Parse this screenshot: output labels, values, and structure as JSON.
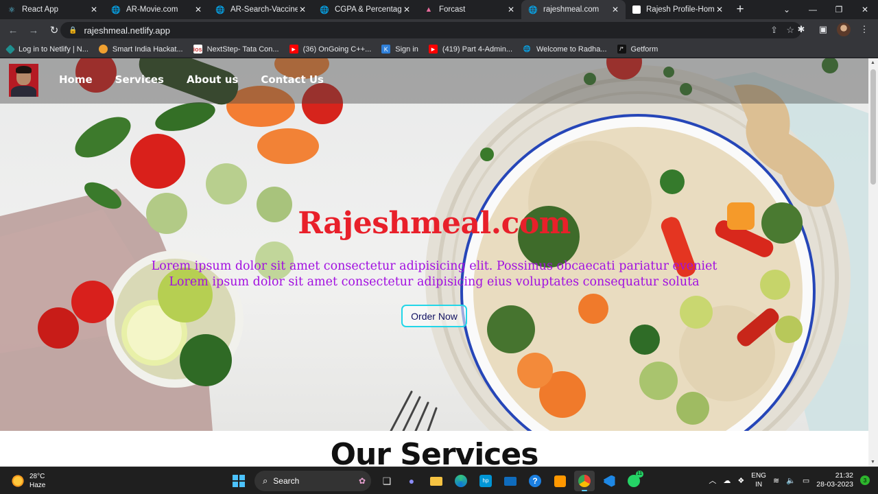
{
  "browser": {
    "tabs": [
      {
        "title": "React App",
        "icon": "react-icon",
        "active": false
      },
      {
        "title": "AR-Movie.com",
        "icon": "globe-icon",
        "active": false
      },
      {
        "title": "AR-Search-Vaccine-p",
        "icon": "globe-icon",
        "active": false
      },
      {
        "title": "CGPA & Percentag",
        "icon": "globe-icon",
        "active": false
      },
      {
        "title": "Forcast",
        "icon": "forecast-icon",
        "active": false
      },
      {
        "title": "rajeshmeal.com",
        "icon": "globe-icon",
        "active": true
      },
      {
        "title": "Rajesh Profile-Home",
        "icon": "page-icon",
        "active": false
      }
    ],
    "url": "rajeshmeal.netlify.app",
    "bookmarks": [
      {
        "label": "Log in to Netlify | N...",
        "icon": "netlify-icon",
        "color": "#1f8f8f"
      },
      {
        "label": "Smart India Hackat...",
        "icon": "sih-icon",
        "color": "#f0a030"
      },
      {
        "label": "NextStep- Tata Con...",
        "icon": "tcs-icon",
        "color": "#d04040"
      },
      {
        "label": "(36) OnGoing C++...",
        "icon": "youtube-icon",
        "color": "#ff0000"
      },
      {
        "label": "Sign in",
        "icon": "kotlin-icon",
        "color": "#2f7fd8"
      },
      {
        "label": "(419) Part 4-Admin...",
        "icon": "youtube-icon",
        "color": "#ff0000"
      },
      {
        "label": "Welcome to Radha...",
        "icon": "globe-icon",
        "color": "#888888"
      },
      {
        "label": "Getform",
        "icon": "getform-icon",
        "color": "#222222"
      }
    ]
  },
  "site": {
    "nav": {
      "home": "Home",
      "services": "Services",
      "about": "About us",
      "contact": "Contact Us"
    },
    "hero": {
      "title": "Rajeshmeal.com",
      "line1": "Lorem ipsum dolor sit amet consectetur adipisicing elit. Possimus obcaecati pariatur eveniet",
      "line2": "Lorem ipsum dolor sit amet consectetur adipisicing eius voluptates consequatur soluta",
      "button": "Order Now"
    },
    "services_title": "Our Services",
    "colors": {
      "title": "#e8202a",
      "text": "#a10fe0",
      "button_border": "#22d6e8"
    }
  },
  "taskbar": {
    "temperature": "28°C",
    "condition": "Haze",
    "search": "Search",
    "lang_top": "ENG",
    "lang_bottom": "IN",
    "time": "21:32",
    "date": "28-03-2023",
    "notifications": "3",
    "whatsapp_badge": "11"
  }
}
